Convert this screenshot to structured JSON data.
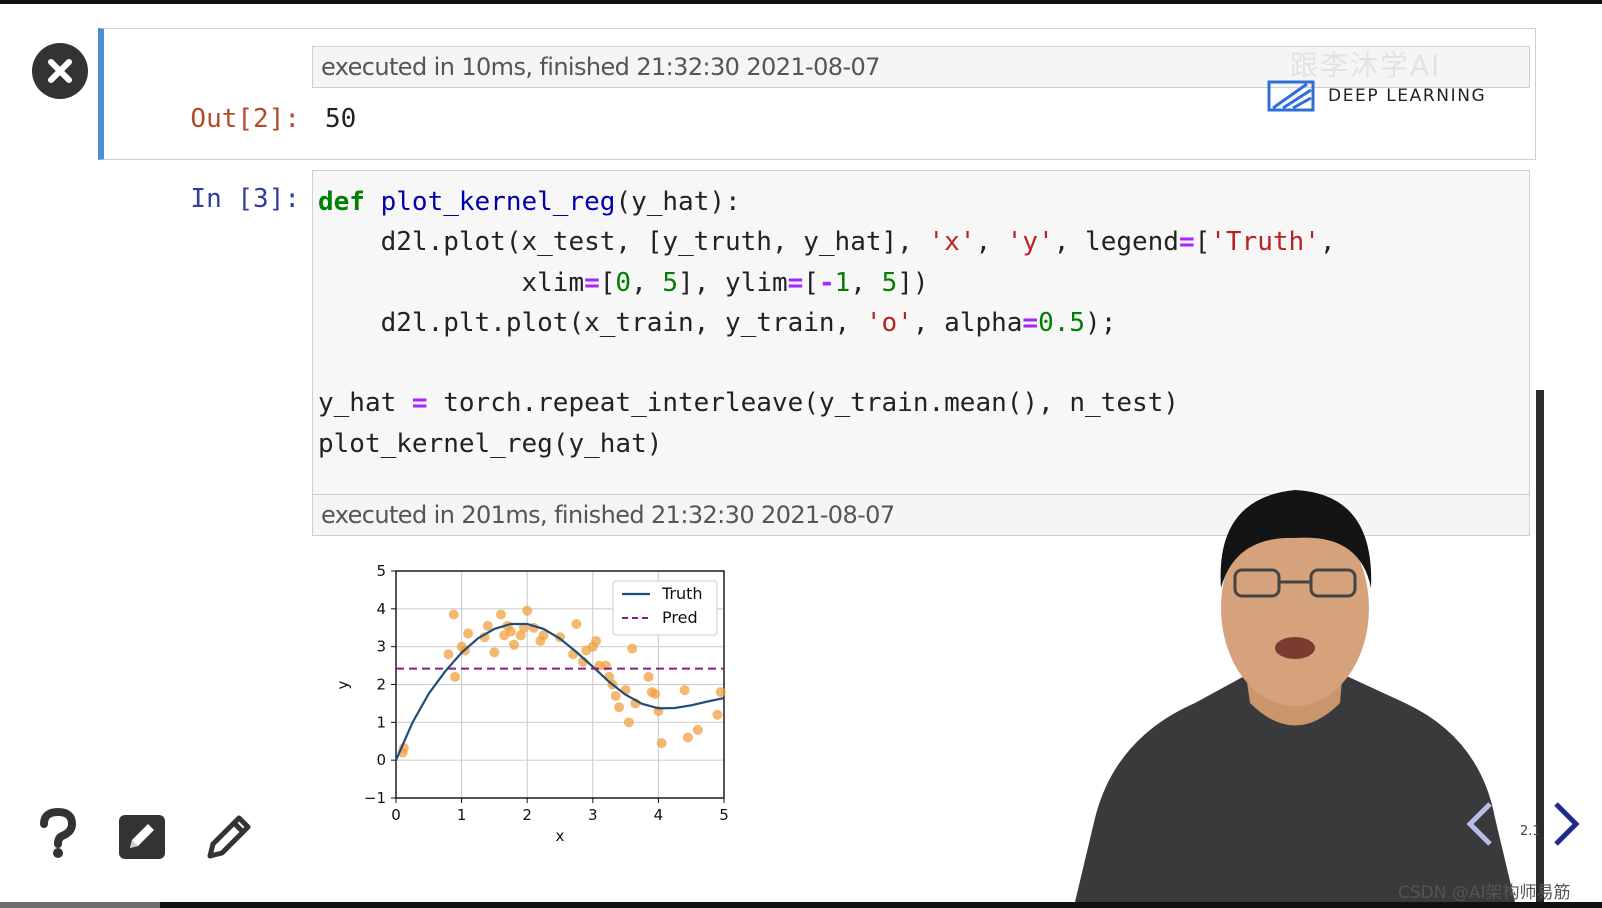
{
  "notebook": {
    "cell2": {
      "exec_info": "executed in 10ms, finished 21:32:30 2021-08-07",
      "out_prompt": "Out[2]:",
      "out_value": "50"
    },
    "cell3": {
      "in_prompt": "In [3]:",
      "code_lines": [
        "def plot_kernel_reg(y_hat):",
        "    d2l.plot(x_test, [y_truth, y_hat], 'x', 'y', legend=['Truth',",
        "             xlim=[0, 5], ylim=[-1, 5])",
        "    d2l.plt.plot(x_train, y_train, 'o', alpha=0.5);",
        "",
        "y_hat = torch.repeat_interleave(y_train.mean(), n_test)",
        "plot_kernel_reg(y_hat)"
      ],
      "exec_info": "executed in 201ms, finished 21:32:30 2021-08-07"
    }
  },
  "branding": {
    "logo_text": "DEEP LEARNING",
    "watermark": "跟李沐学AI",
    "footer_credit": "CSDN @AI架构师易筋",
    "page_indicator": "2.1"
  },
  "icons": {
    "close": "close-icon",
    "help": "question-icon",
    "edit_box": "edit-box-icon",
    "pencil": "pencil-icon",
    "prev": "chevron-left-icon",
    "next": "chevron-right-icon"
  },
  "colors": {
    "cell_accent": "#4a90d9",
    "truth_line": "#1f4e79",
    "pred_line": "#8b1a8b",
    "points": "#f0a040"
  },
  "chart_data": {
    "type": "line",
    "xlabel": "x",
    "ylabel": "y",
    "xlim": [
      0,
      5
    ],
    "ylim": [
      -1,
      5
    ],
    "xticks": [
      "0",
      "1",
      "2",
      "3",
      "4",
      "5"
    ],
    "yticks": [
      "−1",
      "0",
      "1",
      "2",
      "3",
      "4",
      "5"
    ],
    "grid": true,
    "legend_position": "top-right",
    "series": [
      {
        "name": "Truth",
        "style": "solid",
        "x": [
          0,
          0.25,
          0.5,
          0.75,
          1,
          1.25,
          1.5,
          1.75,
          2,
          2.25,
          2.5,
          2.75,
          3,
          3.25,
          3.5,
          3.75,
          4,
          4.25,
          4.5,
          4.75,
          5
        ],
        "y": [
          0,
          0.99,
          1.76,
          2.35,
          2.84,
          3.22,
          3.47,
          3.6,
          3.6,
          3.47,
          3.21,
          2.86,
          2.47,
          2.07,
          1.73,
          1.49,
          1.37,
          1.38,
          1.45,
          1.55,
          1.64
        ]
      },
      {
        "name": "Pred",
        "style": "dashed",
        "x": [
          0,
          5
        ],
        "y": [
          2.42,
          2.42
        ]
      }
    ],
    "scatter_points": [
      [
        0.1,
        0.2
      ],
      [
        0.12,
        0.32
      ],
      [
        0.8,
        2.8
      ],
      [
        0.88,
        3.85
      ],
      [
        0.9,
        2.2
      ],
      [
        1,
        3.0
      ],
      [
        1.05,
        2.9
      ],
      [
        1.1,
        3.35
      ],
      [
        1.35,
        3.25
      ],
      [
        1.4,
        3.55
      ],
      [
        1.5,
        2.85
      ],
      [
        1.6,
        3.85
      ],
      [
        1.65,
        3.3
      ],
      [
        1.7,
        3.55
      ],
      [
        1.75,
        3.4
      ],
      [
        1.8,
        3.05
      ],
      [
        1.9,
        3.3
      ],
      [
        1.95,
        3.5
      ],
      [
        2.0,
        3.95
      ],
      [
        2.1,
        3.5
      ],
      [
        2.2,
        3.15
      ],
      [
        2.25,
        3.3
      ],
      [
        2.5,
        3.25
      ],
      [
        2.7,
        2.8
      ],
      [
        2.75,
        3.6
      ],
      [
        2.85,
        2.6
      ],
      [
        2.9,
        2.9
      ],
      [
        3.0,
        3.0
      ],
      [
        3.05,
        3.15
      ],
      [
        3.1,
        2.5
      ],
      [
        3.2,
        2.5
      ],
      [
        3.25,
        2.2
      ],
      [
        3.3,
        2.0
      ],
      [
        3.35,
        1.7
      ],
      [
        3.4,
        1.4
      ],
      [
        3.5,
        1.85
      ],
      [
        3.55,
        1.0
      ],
      [
        3.6,
        2.95
      ],
      [
        3.65,
        1.5
      ],
      [
        3.85,
        2.2
      ],
      [
        3.9,
        1.8
      ],
      [
        3.95,
        1.75
      ],
      [
        4.0,
        1.3
      ],
      [
        4.05,
        0.45
      ],
      [
        4.4,
        1.85
      ],
      [
        4.45,
        0.6
      ],
      [
        4.6,
        0.8
      ],
      [
        4.9,
        1.2
      ],
      [
        4.95,
        1.8
      ]
    ]
  }
}
